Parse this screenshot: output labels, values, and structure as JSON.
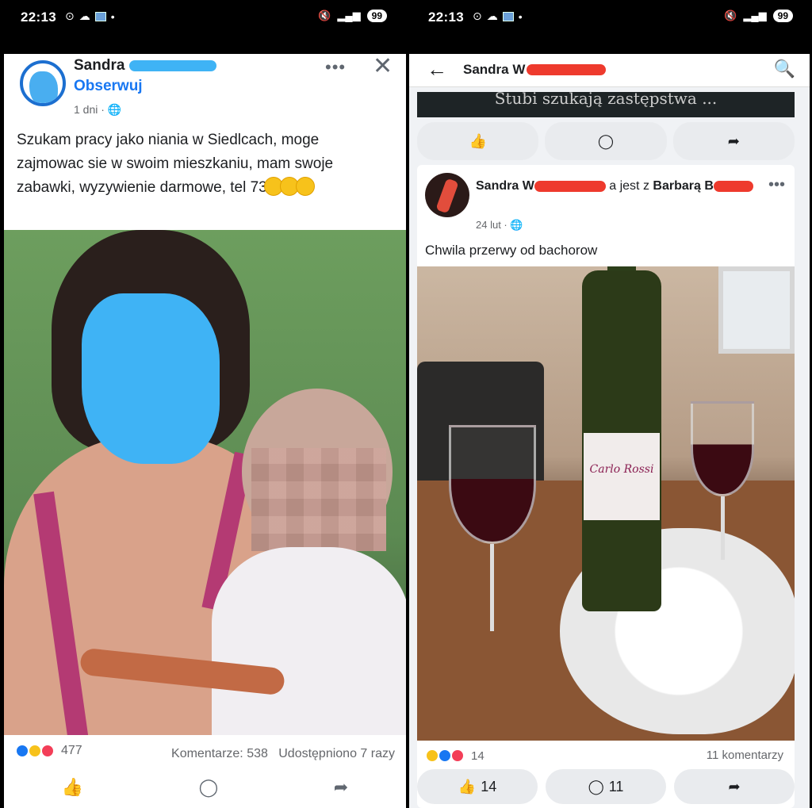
{
  "left": {
    "status": {
      "time": "22:13",
      "battery": "99"
    },
    "post": {
      "author": "Sandra",
      "follow_label": "Obserwuj",
      "meta": "1 dni ·",
      "more": "•••",
      "close": "✕",
      "text": "Szukam pracy jako niania w Siedlcach, moge zajmowac sie w swoim mieszkaniu, mam swoje zabawki, wyzywienie darmowe, tel 73",
      "reaction_count": "477",
      "comments": "Komentarze: 538",
      "shares": "Udostępniono 7 razy"
    }
  },
  "right": {
    "status": {
      "time": "22:13",
      "battery": "99"
    },
    "topbar": {
      "title": "Sandra W"
    },
    "prev_banner_text": "Stubi szukają zastępstwa ...",
    "post": {
      "author_prefix": "Sandra W",
      "with_text": "a jest z",
      "tagged": "Barbarą B",
      "meta": "24 lut ·",
      "more": "•••",
      "text": "Chwila przerwy od bachorow",
      "label_text": "Carlo Rossi",
      "reaction_count": "14",
      "comments": "11 komentarzy",
      "like_count": "14",
      "comment_count": "11"
    }
  },
  "colors": {
    "facebook_blue": "#1877f2",
    "redact_blue": "#3fb3f5",
    "redact_red": "#ee3a2d"
  }
}
